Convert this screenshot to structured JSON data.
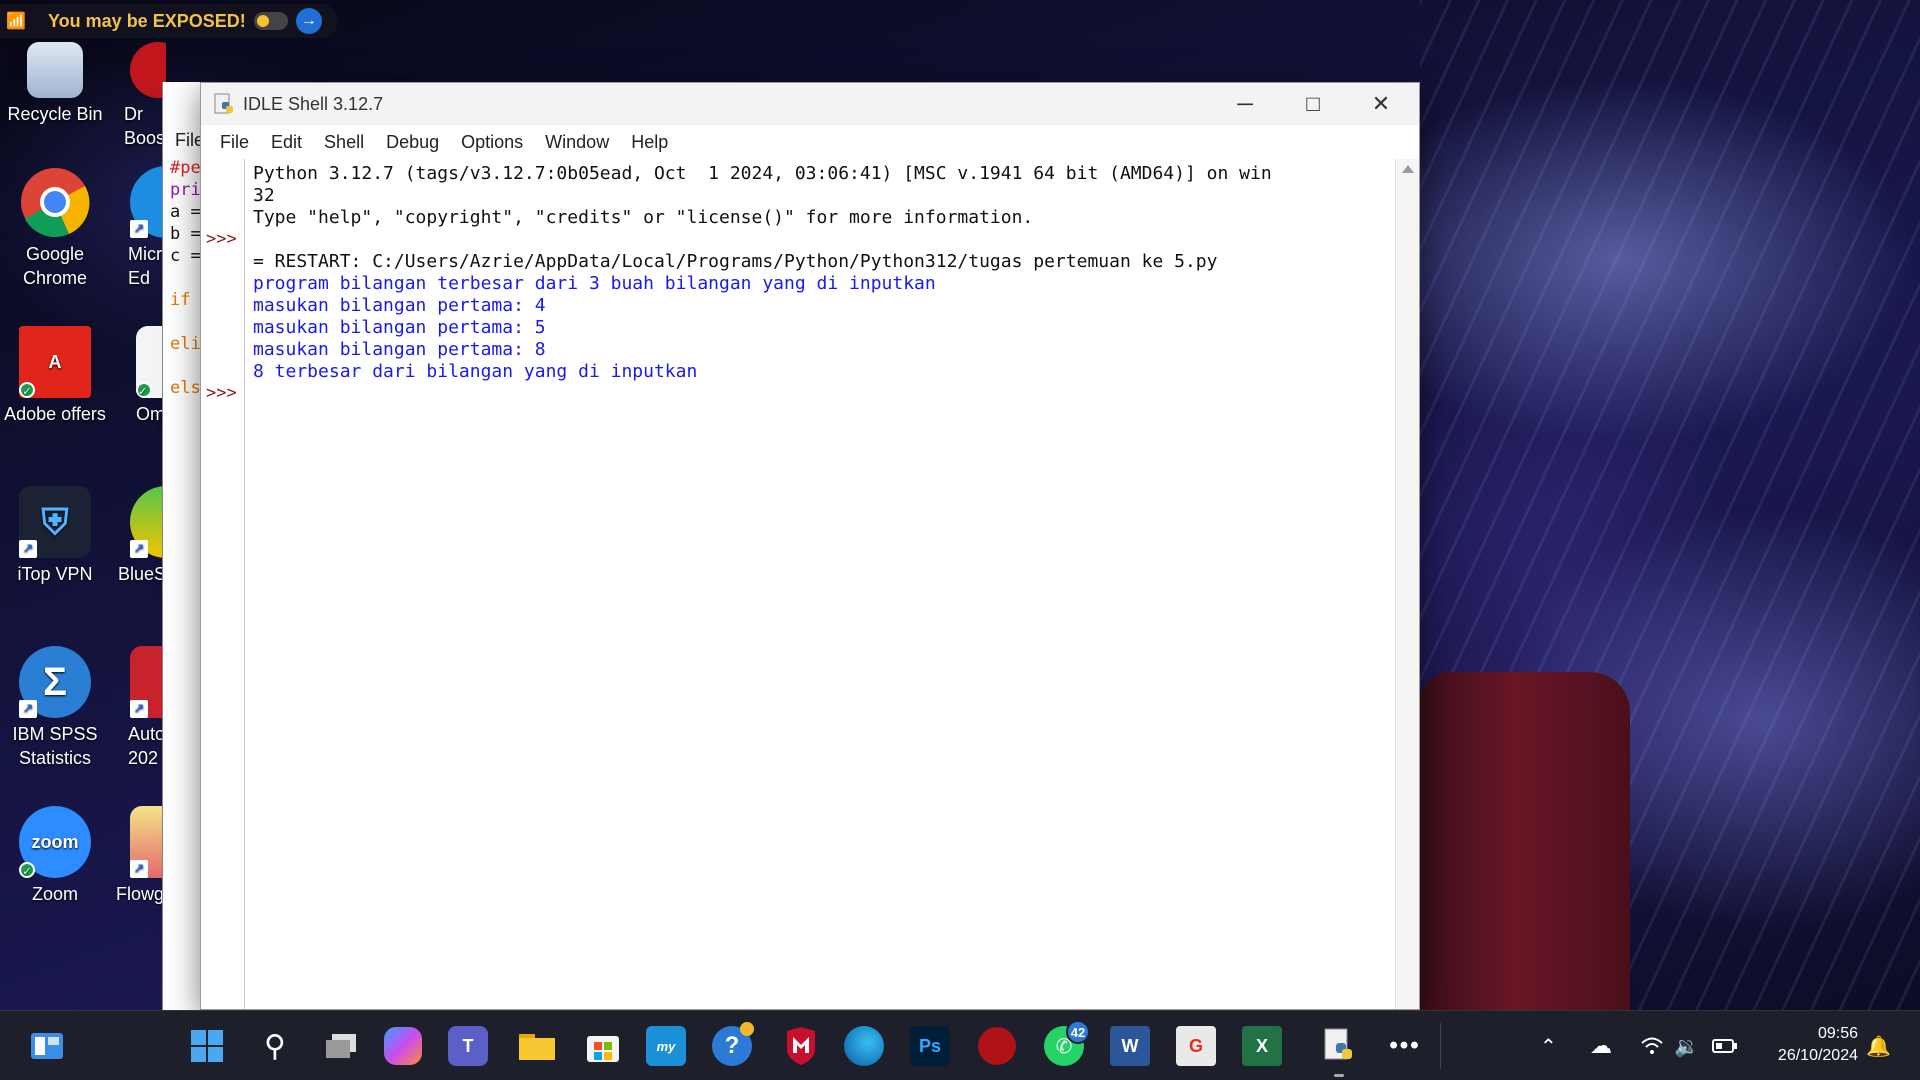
{
  "banner": {
    "text": "You may be EXPOSED!"
  },
  "desktop_icons": [
    {
      "label": "Recycle Bin"
    },
    {
      "label": "Dr Boos"
    },
    {
      "label": "Google Chrome"
    },
    {
      "label": "Micr Ed"
    },
    {
      "label": "Adobe offers"
    },
    {
      "label": "Om"
    },
    {
      "label": "iTop VPN"
    },
    {
      "label": "BlueS"
    },
    {
      "label": "IBM SPSS Statistics"
    },
    {
      "label": "Auto 202"
    },
    {
      "label": "Zoom"
    },
    {
      "label": "Flowg"
    }
  ],
  "back_window": {
    "menu_file": "File",
    "lines": [
      "#pe",
      "pri",
      "a =",
      "b =",
      "c =",
      "",
      "if",
      "",
      "eli",
      "",
      "els"
    ]
  },
  "idle": {
    "title": "IDLE Shell 3.12.7",
    "menu": [
      "File",
      "Edit",
      "Shell",
      "Debug",
      "Options",
      "Window",
      "Help"
    ],
    "prompt": ">>>",
    "lines": [
      {
        "text": "Python 3.12.7 (tags/v3.12.7:0b05ead, Oct  1 2024, 03:06:41) [MSC v.1941 64 bit (AMD64)] on win",
        "color": "black"
      },
      {
        "text": "32",
        "color": "black"
      },
      {
        "text": "Type \"help\", \"copyright\", \"credits\" or \"license()\" for more information.",
        "color": "black"
      },
      {
        "text": "",
        "color": "black"
      },
      {
        "text": "= RESTART: C:/Users/Azrie/AppData/Local/Programs/Python/Python312/tugas pertemuan ke 5.py",
        "color": "black"
      },
      {
        "text": "program bilangan terbesar dari 3 buah bilangan yang di inputkan",
        "color": "blue"
      },
      {
        "text": "masukan bilangan pertama: 4",
        "color": "blue"
      },
      {
        "text": "masukan bilangan pertama: 5",
        "color": "blue"
      },
      {
        "text": "masukan bilangan pertama: 8",
        "color": "blue"
      },
      {
        "text": "8 terbesar dari bilangan yang di inputkan",
        "color": "blue"
      }
    ]
  },
  "taskbar": {
    "whatsapp_badge": "42",
    "apps": [
      "widgets",
      "start",
      "search",
      "task-view",
      "copilot",
      "teams",
      "file-explorer",
      "store",
      "myhp",
      "help",
      "mcafee",
      "edge",
      "photoshop",
      "game",
      "whatsapp",
      "word",
      "foxit",
      "excel",
      "idle",
      "more"
    ]
  },
  "clock": {
    "time": "09:56",
    "date": "26/10/2024"
  },
  "colors": {
    "idle_blue": "#1a1aee",
    "prompt_red": "#8b1a1a",
    "taskbar_bg": "#1d1f2b"
  }
}
